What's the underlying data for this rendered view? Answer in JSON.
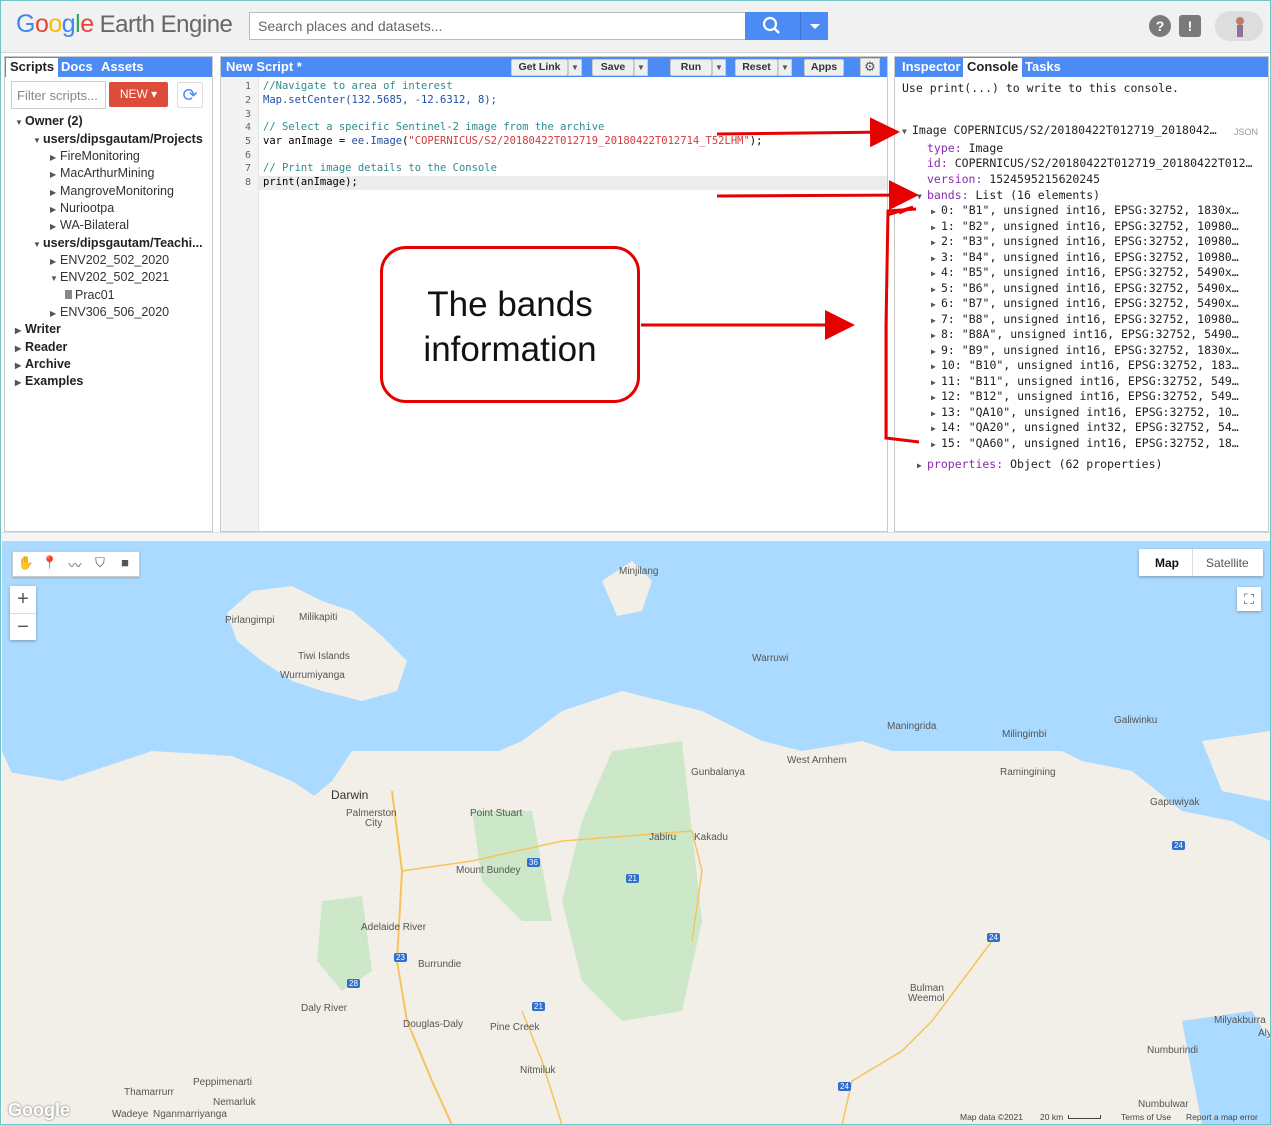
{
  "app": {
    "logo_google": "Google",
    "logo_product": "Earth Engine",
    "search_placeholder": "Search places and datasets..."
  },
  "left_panel": {
    "tabs": [
      "Scripts",
      "Docs",
      "Assets"
    ],
    "filter_placeholder": "Filter scripts...",
    "new_button": "NEW",
    "tree": {
      "owner": "Owner  (2)",
      "projects_repo": "users/dipsgautam/Projects",
      "projects": [
        "FireMonitoring",
        "MacArthurMining",
        "MangroveMonitoring",
        "Nuriootpa",
        "WA-Bilateral"
      ],
      "teaching_repo": "users/dipsgautam/Teachi...",
      "teaching": [
        "ENV202_502_2020",
        "ENV202_502_2021"
      ],
      "teaching_file": "Prac01",
      "teaching_last": "ENV306_506_2020",
      "writer": "Writer",
      "reader": "Reader",
      "archive": "Archive",
      "examples": "Examples"
    }
  },
  "editor": {
    "title": "New Script *",
    "buttons": {
      "get_link": "Get Link",
      "save": "Save",
      "run": "Run",
      "reset": "Reset",
      "apps": "Apps"
    },
    "line_numbers": [
      "1",
      "2",
      "3",
      "4",
      "5",
      "6",
      "7",
      "8"
    ],
    "code": {
      "l1": "//Navigate to area of interest",
      "l2_fn": "Map.setCenter",
      "l2_args": "(132.5685, -12.6312, 8);",
      "l4": "// Select a specific Sentinel-2 image from the archive",
      "l5_var": "var anImage = ",
      "l5_fn": "ee.Image",
      "l5_str": "\"COPERNICUS/S2/20180422T012719_20180422T012714_T52LHM\"",
      "l5_end": ");",
      "l7": "// Print image details to the Console",
      "l8": "print(anImage);"
    }
  },
  "console": {
    "tabs": [
      "Inspector",
      "Console",
      "Tasks"
    ],
    "hint": "Use print(...) to write to this console.",
    "json_label": "JSON",
    "image_header": "Image COPERNICUS/S2/20180422T012719_2018042…",
    "type_key": "type:",
    "type_val": "Image",
    "id_key": "id:",
    "id_val": "COPERNICUS/S2/20180422T012719_20180422T012…",
    "version_key": "version:",
    "version_val": "1524595215620245",
    "bands_key": "bands:",
    "bands_val": "List (16 elements)",
    "bands": [
      "0: \"B1\", unsigned int16, EPSG:32752, 1830x…",
      "1: \"B2\", unsigned int16, EPSG:32752, 10980…",
      "2: \"B3\", unsigned int16, EPSG:32752, 10980…",
      "3: \"B4\", unsigned int16, EPSG:32752, 10980…",
      "4: \"B5\", unsigned int16, EPSG:32752, 5490x…",
      "5: \"B6\", unsigned int16, EPSG:32752, 5490x…",
      "6: \"B7\", unsigned int16, EPSG:32752, 5490x…",
      "7: \"B8\", unsigned int16, EPSG:32752, 10980…",
      "8: \"B8A\", unsigned int16, EPSG:32752, 5490…",
      "9: \"B9\", unsigned int16, EPSG:32752, 1830x…",
      "10: \"B10\", unsigned int16, EPSG:32752, 183…",
      "11: \"B11\", unsigned int16, EPSG:32752, 549…",
      "12: \"B12\", unsigned int16, EPSG:32752, 549…",
      "13: \"QA10\", unsigned int16, EPSG:32752, 10…",
      "14: \"QA20\", unsigned int32, EPSG:32752, 54…",
      "15: \"QA60\", unsigned int16, EPSG:32752, 18…"
    ],
    "properties_key": "properties:",
    "properties_val": "Object (62 properties)"
  },
  "map": {
    "type_buttons": [
      "Map",
      "Satellite"
    ],
    "places": {
      "minjilang": "Minjilang",
      "pirlangimpi": "Pirlangimpi",
      "milikapiti": "Milikapiti",
      "tiwi": "Tiwi Islands",
      "wurrumiyanga": "Wurrumiyanga",
      "warruwi": "Warruwi",
      "maningrida": "Maningrida",
      "galiwinku": "Galiwinku",
      "milingimbi": "Milingimbi",
      "west_arnhem": "West Arnhem",
      "gunbalanya": "Gunbalanya",
      "ramingining": "Ramingining",
      "darwin": "Darwin",
      "palmerston": "Palmerston",
      "city": "City",
      "point_stuart": "Point Stuart",
      "jabiru": "Jabiru",
      "kakadu": "Kakadu",
      "gapuwiyak": "Gapuwiyak",
      "mount_bundey": "Mount Bundey",
      "adelaide_river": "Adelaide River",
      "burrundie": "Burrundie",
      "daly_river": "Daly River",
      "douglas_daly": "Douglas-Daly",
      "pine_creek": "Pine Creek",
      "bulman": "Bulman",
      "weemol": "Weemol",
      "milyakburra": "Milyakburra",
      "aly": "Aly",
      "numbulwar": "Numbulwar",
      "numburindi": "Numburindi",
      "nitmiluk": "Nitmiluk",
      "peppimenarti": "Peppimenarti",
      "thamarrurr": "Thamarrurr",
      "nemarluk": "Nemarluk",
      "wadeye": "Wadeye",
      "nganmarriyanga": "Nganmarriyanga"
    },
    "roads": [
      "36",
      "21",
      "24",
      "24",
      "23",
      "28",
      "21",
      "24"
    ],
    "footer": {
      "mapdata": "Map data ©2021",
      "scale": "20 km",
      "terms": "Terms of Use",
      "report": "Report a map error"
    },
    "google_logo": "Google"
  },
  "annotation": {
    "callout_line1": "The bands",
    "callout_line2": "information",
    "color": "#e60000"
  }
}
